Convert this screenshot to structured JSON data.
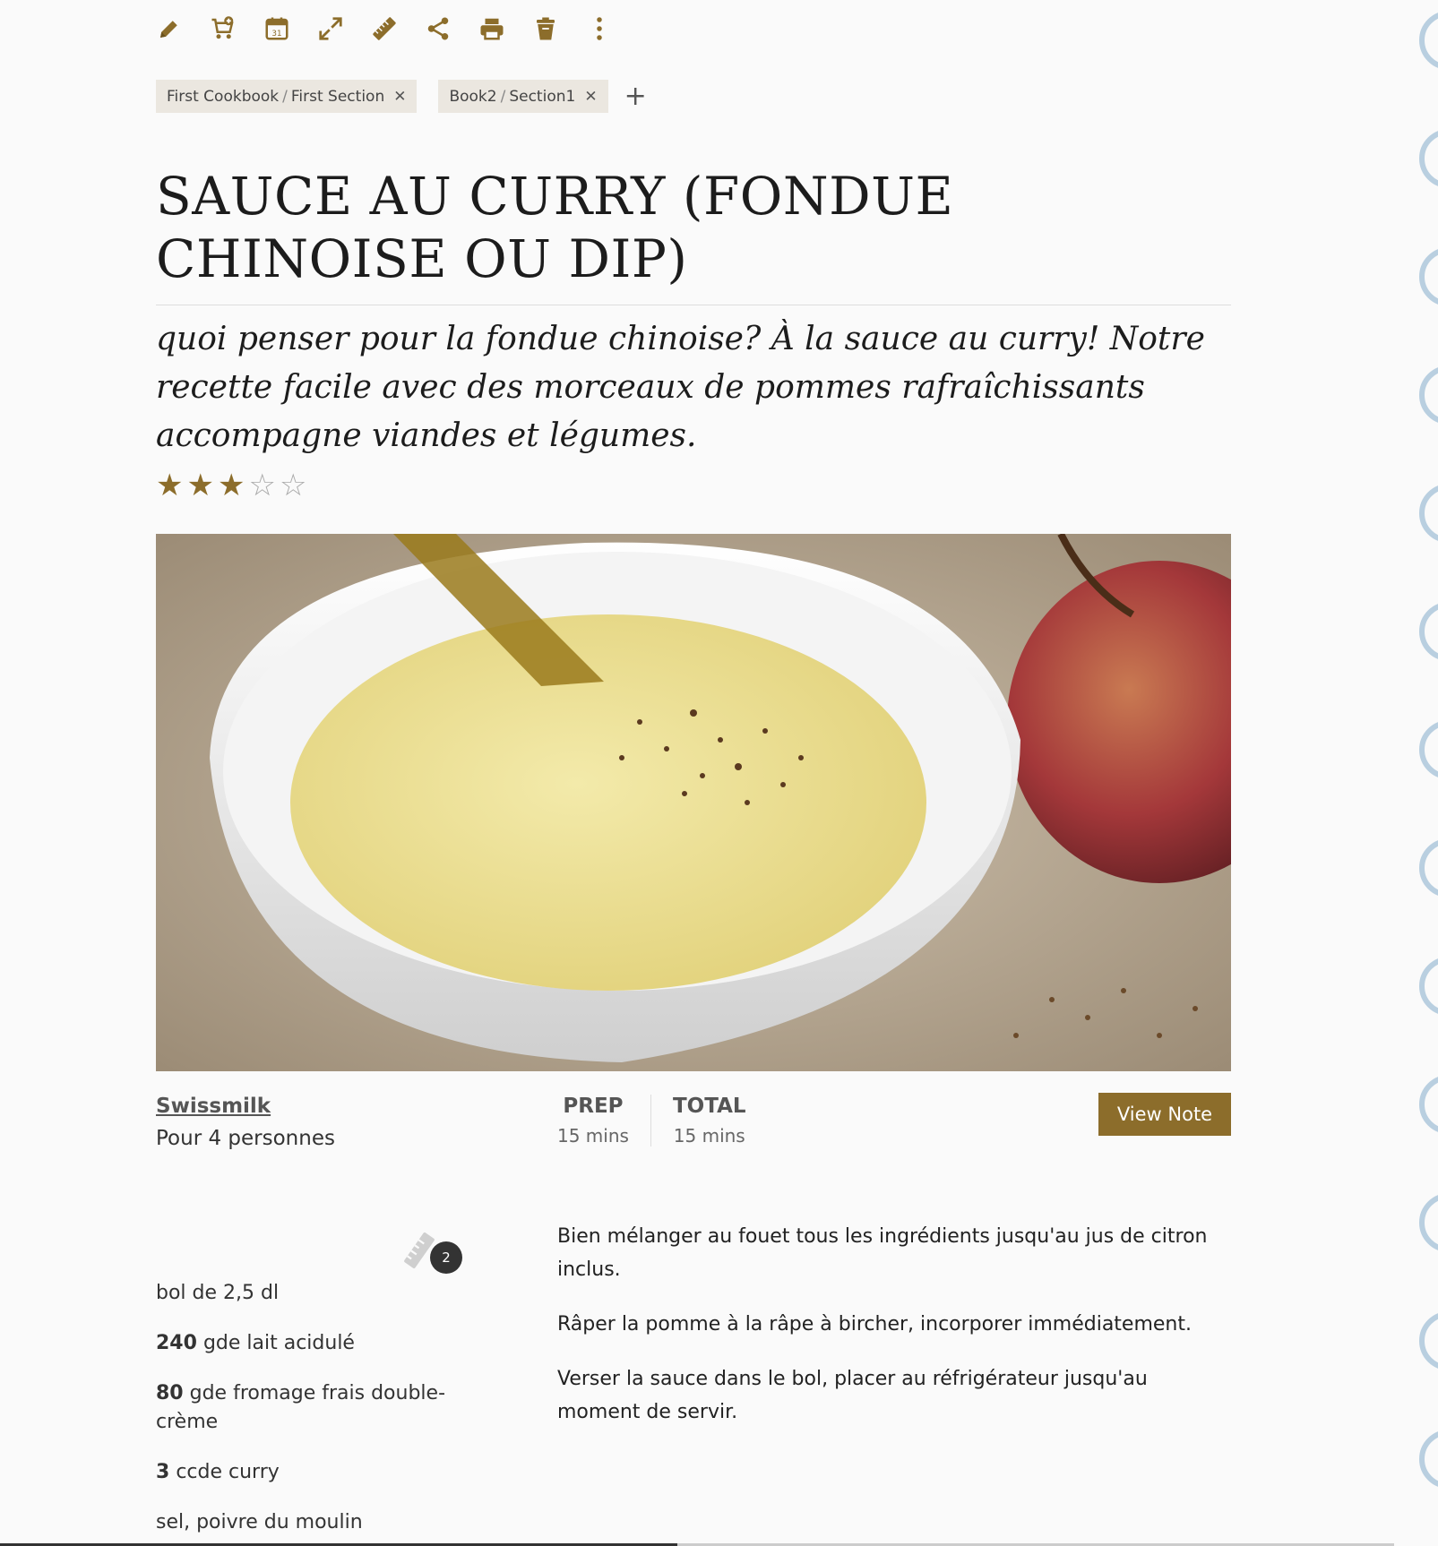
{
  "toolbar": {
    "items": [
      {
        "icon": "pencil-icon",
        "name": "edit"
      },
      {
        "icon": "cart-add-icon",
        "name": "add-to-cart"
      },
      {
        "icon": "calendar-icon",
        "name": "calendar",
        "text": "31"
      },
      {
        "icon": "expand-icon",
        "name": "fullscreen"
      },
      {
        "icon": "ruler-icon",
        "name": "scale"
      },
      {
        "icon": "share-icon",
        "name": "share"
      },
      {
        "icon": "print-icon",
        "name": "print"
      },
      {
        "icon": "trash-icon",
        "name": "delete"
      },
      {
        "icon": "more-vertical-icon",
        "name": "more"
      }
    ]
  },
  "tags": [
    {
      "book": "First Cookbook",
      "section": "First Section"
    },
    {
      "book": "Book2",
      "section": "Section1"
    }
  ],
  "recipe": {
    "title": "SAUCE AU CURRY (FONDUE CHINOISE OU DIP)",
    "description": "quoi penser pour la fondue chinoise? À la sauce au curry! Notre recette facile avec des morceaux de pommes rafraîchissants accompagne viandes et légumes.",
    "rating": 3,
    "rating_max": 5,
    "source": "Swissmilk",
    "serves": "Pour 4 personnes",
    "prep_label": "PREP",
    "prep_value": "15 mins",
    "total_label": "TOTAL",
    "total_value": "15 mins",
    "view_note_label": "View Note",
    "scale_badge": "2"
  },
  "ingredients": [
    {
      "qty": "",
      "text": "bol de 2,5 dl"
    },
    {
      "qty": "240",
      "text": "gde lait acidulé"
    },
    {
      "qty": "80",
      "text": "gde fromage frais double-crème"
    },
    {
      "qty": "3",
      "text": "ccde curry"
    },
    {
      "qty": "",
      "text": "sel, poivre du moulin"
    }
  ],
  "directions": [
    "Bien mélanger au fouet tous les ingrédients jusqu'au jus de citron inclus.",
    "Râper la pomme à la râpe à bircher, incorporer immédiatement.",
    "Verser la sauce dans le bol, placer au réfrigérateur jusqu'au moment de servir."
  ],
  "colors": {
    "accent": "#8c6d2b",
    "tag_bg": "#ebe7e0",
    "deco": "#b9cfe0"
  }
}
